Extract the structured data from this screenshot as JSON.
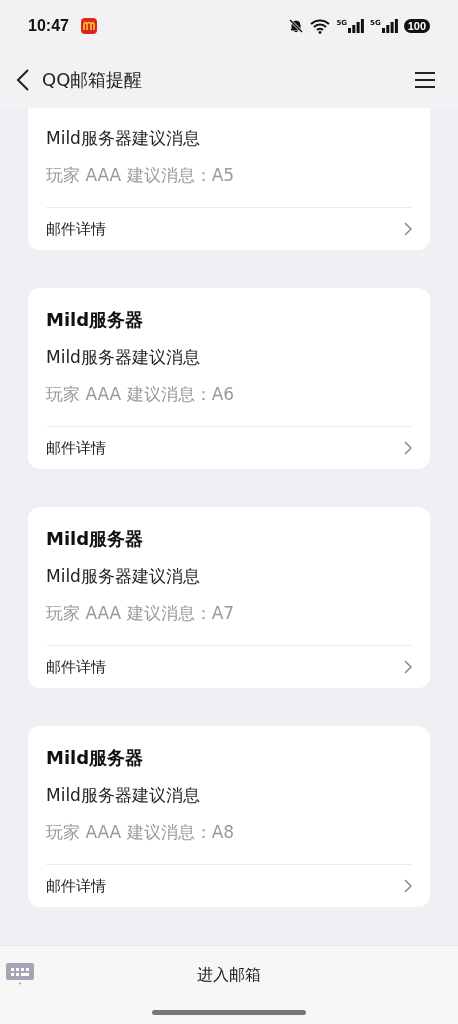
{
  "status_bar": {
    "time": "10:47",
    "signals": [
      "5G",
      "5G"
    ],
    "battery": "100"
  },
  "header": {
    "title": "QQ邮箱提醒"
  },
  "messages": [
    {
      "subject": "Mild服务器建议消息",
      "preview": "玩家 AAA 建议消息：A5",
      "link": "邮件详情"
    },
    {
      "sender": "Mild服务器",
      "subject": "Mild服务器建议消息",
      "preview": "玩家 AAA 建议消息：A6",
      "link": "邮件详情"
    },
    {
      "sender": "Mild服务器",
      "subject": "Mild服务器建议消息",
      "preview": "玩家 AAA 建议消息：A7",
      "link": "邮件详情"
    },
    {
      "sender": "Mild服务器",
      "subject": "Mild服务器建议消息",
      "preview": "玩家 AAA 建议消息：A8",
      "link": "邮件详情"
    }
  ],
  "bottom_bar": {
    "button": "进入邮箱"
  }
}
